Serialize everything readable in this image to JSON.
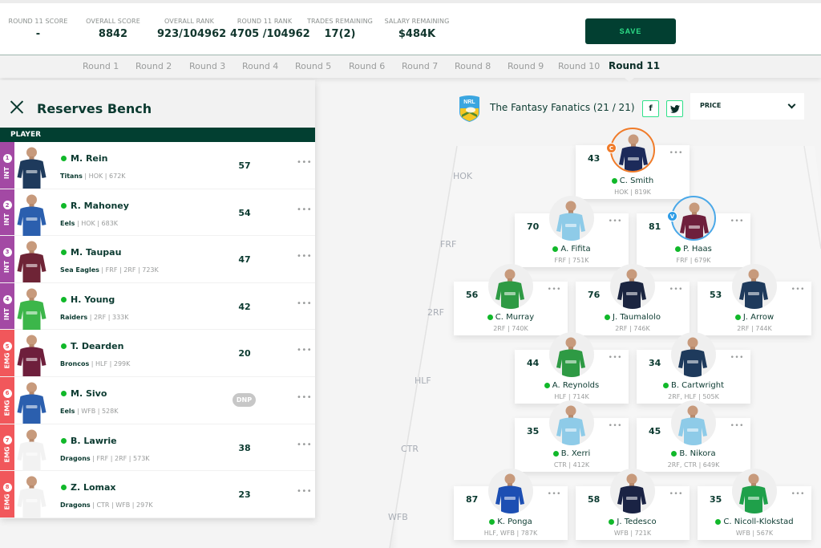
{
  "stats": [
    {
      "label": "ROUND 11 SCORE",
      "value": "-"
    },
    {
      "label": "OVERALL SCORE",
      "value": "8842"
    },
    {
      "label": "OVERALL RANK",
      "value": "923/104962"
    },
    {
      "label": "ROUND 11 RANK",
      "value": "4705 /104962"
    },
    {
      "label": "TRADES REMAINING",
      "value": "17(2)"
    },
    {
      "label": "SALARY REMAINING",
      "value": "$484K"
    }
  ],
  "save_label": "SAVE",
  "rounds": [
    "Round 1",
    "Round 2",
    "Round 3",
    "Round 4",
    "Round 5",
    "Round 6",
    "Round 7",
    "Round 8",
    "Round 9",
    "Round 10",
    "Round 11"
  ],
  "active_round": "Round 11",
  "bench": {
    "title": "Reserves Bench",
    "column_header": "PLAYER",
    "players": [
      {
        "slot": "1",
        "type": "INT",
        "name": "M. Rein",
        "team": "Titans",
        "meta": " | HOK | 672K",
        "score": "57",
        "status": "available"
      },
      {
        "slot": "2",
        "type": "INT",
        "name": "R. Mahoney",
        "team": "Eels",
        "meta": " | HOK | 683K",
        "score": "54",
        "status": "available"
      },
      {
        "slot": "3",
        "type": "INT",
        "name": "M. Taupau",
        "team": "Sea Eagles",
        "meta": " | FRF | 2RF | 723K",
        "score": "47",
        "status": "available"
      },
      {
        "slot": "4",
        "type": "INT",
        "name": "H. Young",
        "team": "Raiders",
        "meta": " | 2RF | 333K",
        "score": "42",
        "status": "available"
      },
      {
        "slot": "5",
        "type": "EMG",
        "name": "T. Dearden",
        "team": "Broncos",
        "meta": " | HLF | 299K",
        "score": "20",
        "status": "available"
      },
      {
        "slot": "6",
        "type": "EMG",
        "name": "M. Sivo",
        "team": "Eels",
        "meta": " | WFB | 528K",
        "score": "DNP",
        "status": "available"
      },
      {
        "slot": "7",
        "type": "EMG",
        "name": "B. Lawrie",
        "team": "Dragons",
        "meta": " | FRF | 2RF | 573K",
        "score": "38",
        "status": "available"
      },
      {
        "slot": "8",
        "type": "EMG",
        "name": "Z. Lomax",
        "team": "Dragons",
        "meta": " | CTR | WFB | 297K",
        "score": "23",
        "status": "available"
      }
    ]
  },
  "team": {
    "name": "The Fantasy Fanatics (21 / 21)",
    "logo": "NRL",
    "facebook": "f",
    "twitter": "twitter-icon"
  },
  "sort": {
    "selected": "PRICE"
  },
  "positions": [
    "HOK",
    "FRF",
    "2RF",
    "HLF",
    "CTR",
    "WFB"
  ],
  "lineup": [
    {
      "name": "C. Smith",
      "meta": "HOK | 819K",
      "score": "43",
      "role": "captain",
      "role_badge": "C",
      "jersey": "#1c2a5a"
    },
    {
      "name": "A. Fifita",
      "meta": "FRF | 751K",
      "score": "70",
      "role": "",
      "role_badge": "",
      "jersey": "#8ecbe8"
    },
    {
      "name": "P. Haas",
      "meta": "FRF | 679K",
      "score": "81",
      "role": "vice",
      "role_badge": "V",
      "jersey": "#6e1f3c"
    },
    {
      "name": "C. Murray",
      "meta": "2RF | 740K",
      "score": "56",
      "role": "",
      "role_badge": "",
      "jersey": "#2e9a44"
    },
    {
      "name": "J. Taumalolo",
      "meta": "2RF | 746K",
      "score": "76",
      "role": "",
      "role_badge": "",
      "jersey": "#1b2540"
    },
    {
      "name": "J. Arrow",
      "meta": "2RF | 744K",
      "score": "53",
      "role": "",
      "role_badge": "",
      "jersey": "#1e3a5c"
    },
    {
      "name": "A. Reynolds",
      "meta": "HLF | 714K",
      "score": "44",
      "role": "",
      "role_badge": "",
      "jersey": "#2e9a44"
    },
    {
      "name": "B. Cartwright",
      "meta": "2RF, HLF | 505K",
      "score": "34",
      "role": "",
      "role_badge": "",
      "jersey": "#1e3a5c"
    },
    {
      "name": "B. Xerri",
      "meta": "CTR | 412K",
      "score": "35",
      "role": "",
      "role_badge": "",
      "jersey": "#8ecbe8"
    },
    {
      "name": "B. Nikora",
      "meta": "2RF, CTR | 649K",
      "score": "45",
      "role": "",
      "role_badge": "",
      "jersey": "#8ecbe8"
    },
    {
      "name": "K. Ponga",
      "meta": "HLF, WFB | 787K",
      "score": "87",
      "role": "",
      "role_badge": "",
      "jersey": "#1d4fb3"
    },
    {
      "name": "J. Tedesco",
      "meta": "WFB | 721K",
      "score": "58",
      "role": "",
      "role_badge": "",
      "jersey": "#1a2344"
    },
    {
      "name": "C. Nicoll-Klokstad",
      "meta": "WFB | 567K",
      "score": "35",
      "role": "",
      "role_badge": "",
      "jersey": "#1fa04a"
    }
  ]
}
